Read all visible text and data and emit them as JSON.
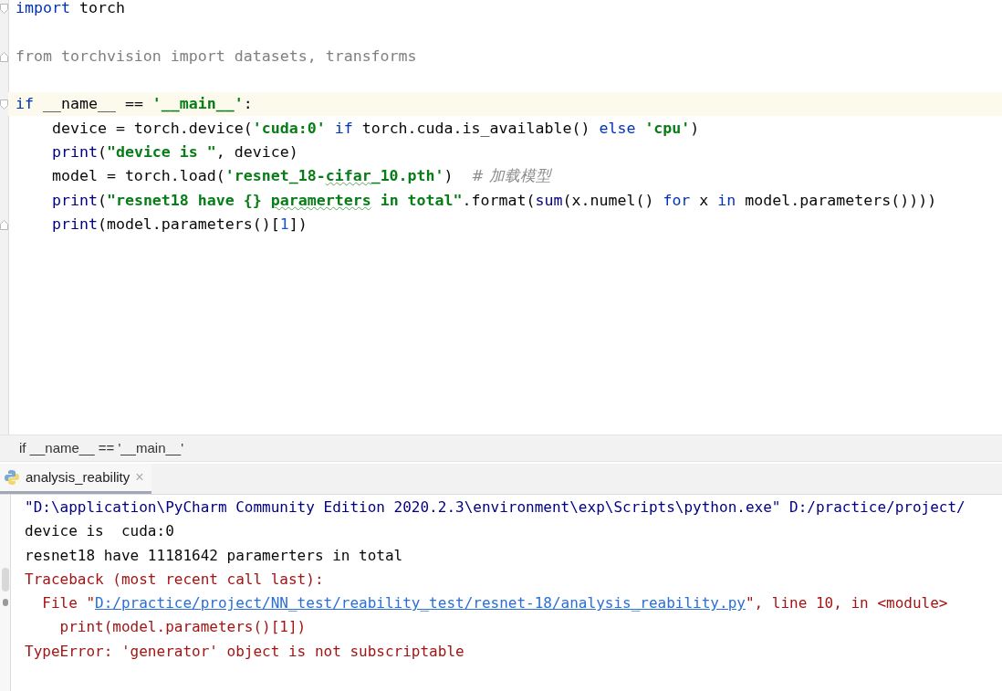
{
  "editor": {
    "lines": [
      {
        "fold_open": true,
        "fold_close": false,
        "current": false,
        "tokens": [
          {
            "text": "import",
            "kind": "keyword"
          },
          {
            "text": " torch",
            "kind": "plain"
          }
        ]
      },
      {
        "fold_open": false,
        "fold_close": false,
        "current": false
      },
      {
        "fold_open": false,
        "fold_close": true,
        "current": false,
        "tokens": [
          {
            "text": "from torchvision import datasets, transforms",
            "kind": "unused"
          }
        ]
      },
      {
        "fold_open": false,
        "fold_close": false,
        "current": false
      },
      {
        "fold_open": true,
        "fold_close": false,
        "current": true,
        "tokens": [
          {
            "text": "if",
            "kind": "keyword"
          },
          {
            "text": " __name__ == ",
            "kind": "plain"
          },
          {
            "text": "'__main__'",
            "kind": "string"
          },
          {
            "text": ":",
            "kind": "plain"
          }
        ]
      },
      {
        "fold_open": false,
        "fold_close": false,
        "current": false,
        "tokens": [
          {
            "text": "    device = torch.device(",
            "kind": "plain"
          },
          {
            "text": "'cuda:0'",
            "kind": "string"
          },
          {
            "text": " if",
            "kind": "keyword"
          },
          {
            "text": " torch.cuda.is_available() ",
            "kind": "plain"
          },
          {
            "text": "else",
            "kind": "keyword"
          },
          {
            "text": " 'cpu'",
            "kind": "string"
          },
          {
            "text": ")",
            "kind": "plain"
          }
        ]
      },
      {
        "fold_open": false,
        "fold_close": false,
        "current": false,
        "tokens": [
          {
            "text": "    print",
            "kind": "builtin"
          },
          {
            "text": "(",
            "kind": "plain"
          },
          {
            "text": "\"device is \"",
            "kind": "string"
          },
          {
            "text": ", device)",
            "kind": "plain"
          }
        ]
      },
      {
        "fold_open": false,
        "fold_close": false,
        "current": false,
        "tokens": [
          {
            "text": "    model = torch.load(",
            "kind": "plain"
          },
          {
            "text": "'resnet_18-",
            "kind": "string",
            "typo": false
          },
          {
            "text": "cifar",
            "kind": "string",
            "typo": true
          },
          {
            "text": "_10.pth'",
            "kind": "string",
            "typo": false
          },
          {
            "text": ")  ",
            "kind": "plain"
          },
          {
            "text": "# 加载模型",
            "kind": "comment"
          }
        ]
      },
      {
        "fold_open": false,
        "fold_close": false,
        "current": false,
        "tokens": [
          {
            "text": "    print",
            "kind": "builtin"
          },
          {
            "text": "(",
            "kind": "plain"
          },
          {
            "text": "\"resnet18 have {} ",
            "kind": "string",
            "typo": false
          },
          {
            "text": "paramerters",
            "kind": "string",
            "typo": true
          },
          {
            "text": " in total\"",
            "kind": "string",
            "typo": false
          },
          {
            "text": ".format(",
            "kind": "plain"
          },
          {
            "text": "sum",
            "kind": "builtin"
          },
          {
            "text": "(x.numel() ",
            "kind": "plain"
          },
          {
            "text": "for",
            "kind": "keyword"
          },
          {
            "text": " x ",
            "kind": "plain"
          },
          {
            "text": "in",
            "kind": "keyword"
          },
          {
            "text": " model.parameters())))",
            "kind": "plain"
          }
        ]
      },
      {
        "fold_open": false,
        "fold_close": true,
        "current": false,
        "tokens": [
          {
            "text": "    print",
            "kind": "builtin"
          },
          {
            "text": "(model.parameters()[",
            "kind": "plain"
          },
          {
            "text": "1",
            "kind": "number"
          },
          {
            "text": "])",
            "kind": "plain"
          }
        ]
      }
    ]
  },
  "breadcrumb": "if __name__ == '__main__'",
  "run_tab": {
    "label": "analysis_reability",
    "selected": true,
    "close": "×"
  },
  "console": [
    {
      "segments": [
        {
          "text": "\"D:\\application\\PyCharm Community Edition 2020.2.3\\environment\\exp\\Scripts\\python.exe\" D:/practice/project/",
          "kind": "command"
        }
      ]
    },
    {
      "segments": [
        {
          "text": "device is  cuda:0",
          "kind": "output"
        }
      ]
    },
    {
      "segments": [
        {
          "text": "resnet18 have 11181642 paramerters in total",
          "kind": "output"
        }
      ]
    },
    {
      "segments": [
        {
          "text": "Traceback (most recent call last):",
          "kind": "error"
        }
      ]
    },
    {
      "segments": [
        {
          "text": "  File \"",
          "kind": "error"
        },
        {
          "text": "D:/practice/project/NN_test/reability_test/resnet-18/analysis_reability.py",
          "kind": "link"
        },
        {
          "text": "\", line 10, in <module>",
          "kind": "error"
        }
      ]
    },
    {
      "segments": [
        {
          "text": "    print(model.parameters()[1])",
          "kind": "error"
        }
      ]
    },
    {
      "segments": [
        {
          "text": "TypeError: 'generator' object is not subscriptable",
          "kind": "error"
        }
      ]
    }
  ]
}
